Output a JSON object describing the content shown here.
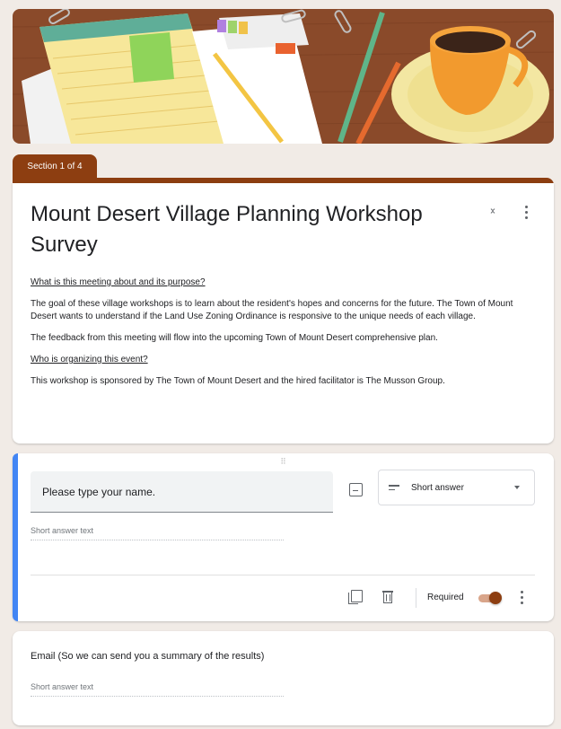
{
  "header": {
    "banner_icon": "desk-illustration-banner",
    "section_tab": "Section 1 of 4",
    "theme_color": "#8d3e11"
  },
  "form": {
    "title": "Mount Desert Village Planning Workshop Survey",
    "description": {
      "heading1": "What is this meeting about and its purpose?",
      "para1": "The goal of these village workshops is to learn about the resident's hopes and concerns for the future. The Town of Mount Desert wants to understand if the Land Use Zoning Ordinance is responsive to the unique needs of each village.",
      "para2": "The feedback from this meeting will flow into the upcoming Town of Mount Desert comprehensive plan.",
      "heading2": "Who is organizing this event?",
      "para3": "This workshop is sponsored by The Town of Mount Desert and the hired facilitator is The Musson Group."
    }
  },
  "question1": {
    "text": "Please type your name.",
    "type_label": "Short answer",
    "answer_hint": "Short answer text",
    "required_label": "Required",
    "required": true,
    "accent_color": "#4285f4"
  },
  "question2": {
    "text": "Email (So we can send you a summary of the results)",
    "answer_hint": "Short answer text"
  }
}
